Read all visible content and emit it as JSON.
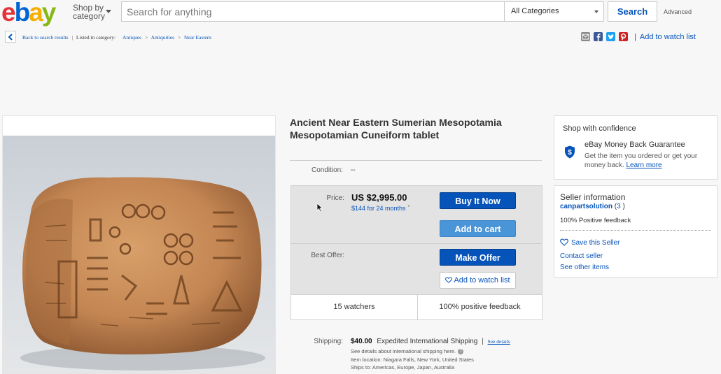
{
  "header": {
    "logo_e": "e",
    "logo_b": "b",
    "logo_a": "a",
    "logo_y": "y",
    "shop_by_line1": "Shop by",
    "shop_by_line2": "category",
    "search_placeholder": "Search for anything",
    "category_selected": "All Categories",
    "search_button": "Search",
    "advanced": "Advanced"
  },
  "breadcrumb": {
    "back": "Back to search results",
    "listed_in": "Listed in category:",
    "items": [
      "Antiques",
      "Antiquities",
      "Near Eastern"
    ],
    "separator": ">"
  },
  "share": {
    "icons": [
      "email-icon",
      "facebook-icon",
      "twitter-icon",
      "pinterest-icon"
    ],
    "add_to_watch": "Add to watch list"
  },
  "listing": {
    "title": "Ancient Near Eastern Sumerian Mesopotamia Mesopotamian Cuneiform tablet",
    "condition_label": "Condition:",
    "condition_value": "--",
    "price_label": "Price:",
    "price_value": "US $2,995.00",
    "monthly": "$144 for 24 months",
    "monthly_marker": "*",
    "buy_it_now": "Buy It Now",
    "add_to_cart": "Add to cart",
    "best_offer_label": "Best Offer:",
    "make_offer": "Make Offer",
    "add_to_watch_list": "Add to watch list",
    "watchers": "15 watchers",
    "positive_feedback": "100% positive feedback"
  },
  "shipping": {
    "label": "Shipping:",
    "cost": "$40.00",
    "method": "Expedited International Shipping",
    "separator": "|",
    "see_details": "See details",
    "intl_note": "See details about international shipping here.",
    "item_location": "Item location:  Niagara Falls, New York, United States",
    "ships_to": "Ships to:  Americas, Europe, Japan, Australia"
  },
  "confidence": {
    "title": "Shop with confidence",
    "guarantee_title": "eBay Money Back Guarantee",
    "guarantee_desc": "Get the item you ordered or get your money back.",
    "learn_more": "Learn more"
  },
  "seller": {
    "title": "Seller information",
    "name": "canpartsolution",
    "score": "3",
    "feedback": "100% Positive feedback",
    "save": "Save this Seller",
    "contact": "Contact seller",
    "other_items": "See other items"
  },
  "colors": {
    "link": "#0654ba",
    "button_primary": "#0654ba",
    "button_secondary": "#4a95d8",
    "logo_red": "#e53238",
    "logo_blue": "#0064d2",
    "logo_yellow": "#f5af02",
    "logo_green": "#86b817"
  }
}
